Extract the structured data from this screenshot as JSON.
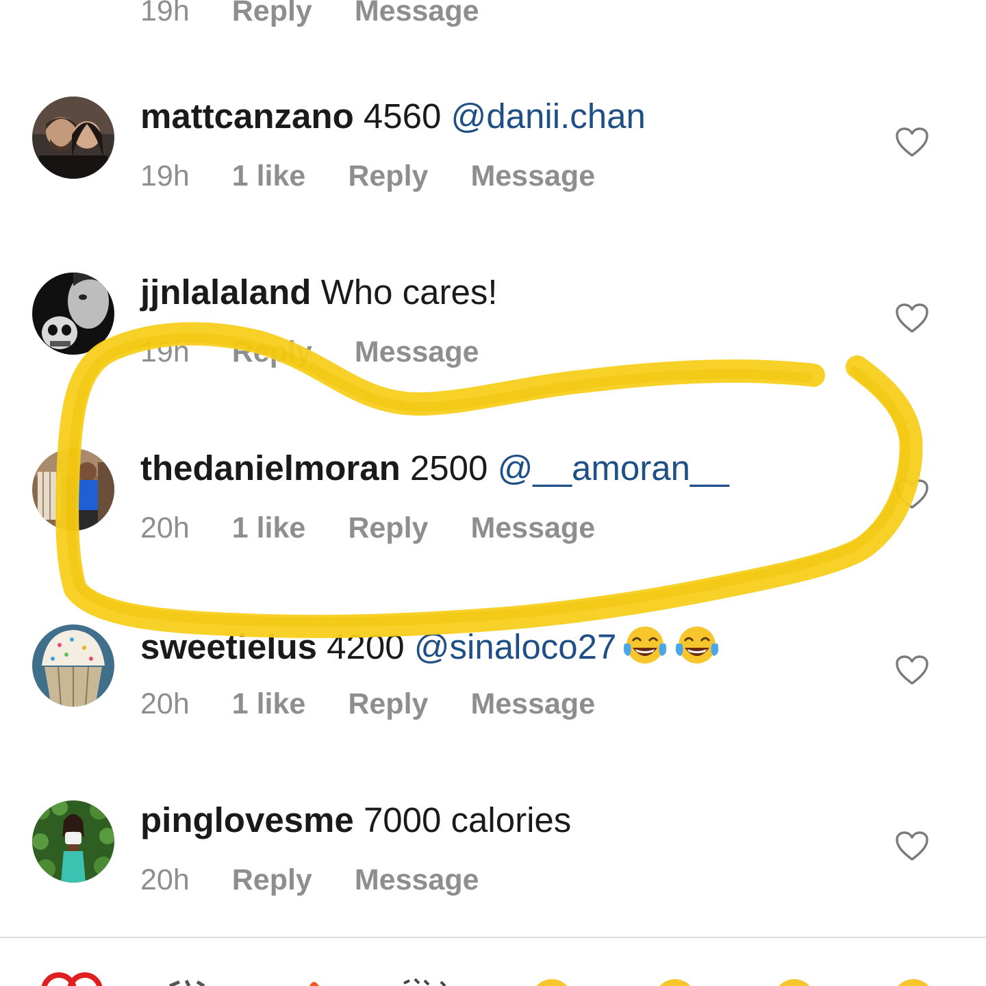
{
  "top_partial": {
    "time": "19h",
    "reply": "Reply",
    "message": "Message"
  },
  "comments": [
    {
      "username": "mattcanzano",
      "text": "4560",
      "mention": "@danii.chan",
      "time": "19h",
      "likes": "1 like",
      "reply": "Reply",
      "message": "Message"
    },
    {
      "username": "jjnlalaland",
      "text": "Who cares!",
      "time": "19h",
      "reply": "Reply",
      "message": "Message"
    },
    {
      "username": "thedanielmoran",
      "text": "2500",
      "mention": "@__amoran__",
      "time": "20h",
      "likes": "1 like",
      "reply": "Reply",
      "message": "Message"
    },
    {
      "username": "sweetielus",
      "text": "4200",
      "mention": "@sinaloco27",
      "emojis": [
        "face-with-tears-of-joy",
        "face-with-tears-of-joy"
      ],
      "time": "20h",
      "likes": "1 like",
      "reply": "Reply",
      "message": "Message"
    },
    {
      "username": "pinglovesme",
      "text": "7000 calories",
      "time": "20h",
      "reply": "Reply",
      "message": "Message"
    }
  ],
  "colors": {
    "username": "#1a1a1a",
    "mention": "#1e4f86",
    "meta": "#8e8e8e",
    "highlight": "#f7cf1c",
    "divider": "#dcdcdc"
  },
  "annotation": {
    "type": "hand-drawn yellow circle",
    "highlights_comment_by": "thedanielmoran"
  }
}
